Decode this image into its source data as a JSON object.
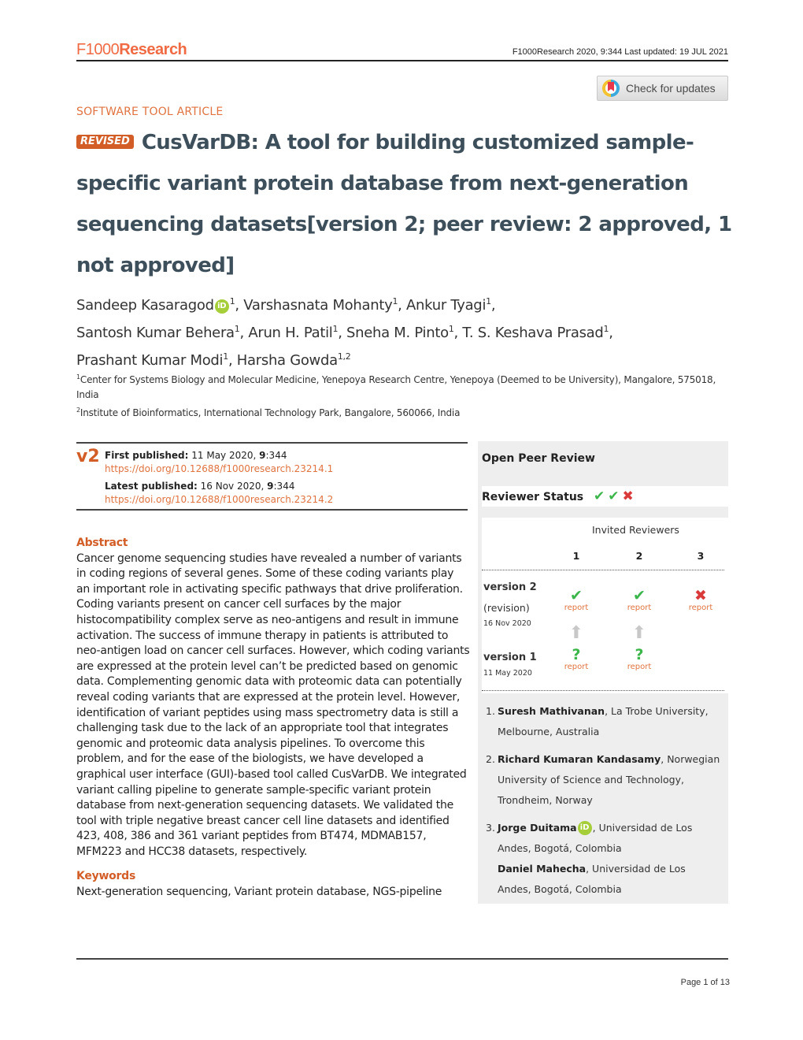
{
  "header": {
    "logo_light": "F1000",
    "logo_bold": "Research",
    "citation": "F1000Research 2020, 9:344 Last updated: 19 JUL 2021",
    "check_updates": "Check for updates"
  },
  "article": {
    "type": "SOFTWARE TOOL ARTICLE",
    "badge": "REVISED",
    "title": "CusVarDB: A tool for building customized sample-specific variant protein database from next-generation sequencing datasets",
    "status": "[version 2; peer review: 2 approved, 1 not approved]",
    "authors": [
      {
        "name": "Sandeep Kasaragod",
        "orcid": true,
        "aff": "1"
      },
      {
        "name": "Varshasnata Mohanty",
        "aff": "1"
      },
      {
        "name": "Ankur Tyagi",
        "aff": "1"
      },
      {
        "name": "Santosh Kumar Behera",
        "aff": "1"
      },
      {
        "name": "Arun H. Patil",
        "aff": "1"
      },
      {
        "name": "Sneha M. Pinto",
        "aff": "1"
      },
      {
        "name": "T. S. Keshava Prasad",
        "aff": "1"
      },
      {
        "name": "Prashant Kumar Modi",
        "aff": "1"
      },
      {
        "name": "Harsha Gowda",
        "aff": "1,2"
      }
    ],
    "affiliations": [
      {
        "num": "1",
        "text": "Center for Systems Biology and Molecular Medicine, Yenepoya Research Centre, Yenepoya (Deemed to be University), Mangalore, 575018, India"
      },
      {
        "num": "2",
        "text": "Institute of Bioinformatics, International Technology Park, Bangalore, 560066, India"
      }
    ]
  },
  "publication": {
    "version_badge": "v2",
    "first_label": "First published:",
    "first_date": " 11 May 2020, ",
    "first_vol": "9",
    "first_page": ":344",
    "first_doi": "https://doi.org/10.12688/f1000research.23214.1",
    "latest_label": "Latest published:",
    "latest_date": " 16 Nov 2020, ",
    "latest_vol": "9",
    "latest_page": ":344",
    "latest_doi": "https://doi.org/10.12688/f1000research.23214.2"
  },
  "abstract": {
    "heading": "Abstract",
    "text": "Cancer genome sequencing studies have revealed a number of variants in coding regions of several genes. Some of these coding variants play an important role in activating specific pathways that drive proliferation. Coding variants present on cancer cell surfaces by the major histocompatibility complex serve as neo-antigens and result in immune activation. The success of immune therapy in patients is attributed to neo-antigen load on cancer cell surfaces. However, which coding variants are expressed at the protein level can’t be predicted based on genomic data. Complementing genomic data with proteomic data can potentially reveal coding variants that are expressed at the protein level. However, identification of variant peptides using mass spectrometry data is still a challenging task due to the lack of an appropriate tool that integrates genomic and proteomic data analysis pipelines. To overcome this problem, and for the ease of the biologists, we have developed a graphical user interface (GUI)-based tool called CusVarDB. We integrated variant calling pipeline to generate sample-specific variant protein database from next-generation sequencing datasets. We validated the tool with triple negative breast cancer cell line datasets and identified 423, 408, 386 and 361 variant peptides from BT474, MDMAB157, MFM223 and HCC38 datasets, respectively.",
    "keywords_heading": "Keywords",
    "keywords": "Next-generation sequencing, Variant protein database, NGS-pipeline"
  },
  "peer_review": {
    "heading": "Open Peer Review",
    "status_label": "Reviewer Status",
    "status_icons": [
      "check-icon",
      "check-icon",
      "cross-icon"
    ],
    "invited_label": "Invited Reviewers",
    "columns": [
      "1",
      "2",
      "3"
    ],
    "versions": [
      {
        "label": "version 2",
        "sub": "(revision)",
        "date": "16 Nov 2020",
        "marks": [
          "approved",
          "approved",
          "not-approved"
        ],
        "report": [
          "report",
          "report",
          "report"
        ]
      },
      {
        "label": "version 1",
        "date": "11 May 2020",
        "marks": [
          "reservations",
          "reservations",
          null
        ],
        "report": [
          "report",
          "report",
          null
        ]
      }
    ],
    "reviewers": [
      {
        "num": "1.",
        "name": "Suresh Mathivanan",
        "affil": ", La Trobe University, Melbourne, Australia"
      },
      {
        "num": "2.",
        "name": "Richard Kumaran Kandasamy",
        "affil": ", Norwegian University of Science and Technology, Trondheim, Norway"
      },
      {
        "num": "3.",
        "name": "Jorge Duitama",
        "orcid": true,
        "affil": ", Universidad de Los Andes, Bogotá, Colombia",
        "co_name": "Daniel Mahecha",
        "co_affil": ", Universidad de Los Andes, Bogotá, Colombia"
      }
    ]
  },
  "footer": {
    "page": "Page 1 of 13"
  },
  "colors": {
    "brand_orange": "#f06b44",
    "accent_orange": "#d35d26",
    "link_orange": "#e0733f",
    "title_slate": "#3e4f5c",
    "approved_green": "#3cb64b",
    "rejected_red": "#d93a3a",
    "orcid_green": "#a6ce39"
  }
}
